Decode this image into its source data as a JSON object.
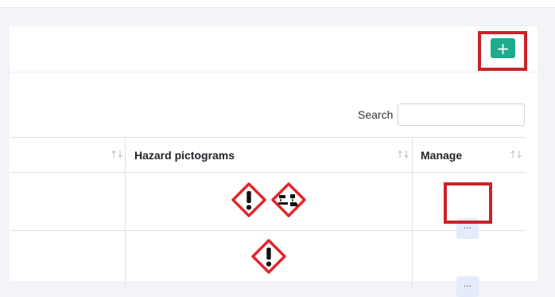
{
  "header": {
    "add_button_label": "+"
  },
  "search": {
    "label": "Search",
    "value": "",
    "placeholder": ""
  },
  "table": {
    "columns": [
      {
        "label": "",
        "sortable": true
      },
      {
        "label": "Hazard pictograms",
        "sortable": true
      },
      {
        "label": "Manage",
        "sortable": true
      }
    ],
    "sort_glyph": "↑↓",
    "rows": [
      {
        "pictograms": [
          "exclamation-mark-pictogram-icon",
          "corrosion-pictogram-icon"
        ],
        "manage_label": "···"
      },
      {
        "pictograms": [
          "exclamation-mark-pictogram-icon"
        ],
        "manage_label": "···"
      }
    ]
  },
  "colors": {
    "accent": "#1eab8d",
    "highlight": "#c9222a",
    "pictogram_border": "#e3262b"
  }
}
